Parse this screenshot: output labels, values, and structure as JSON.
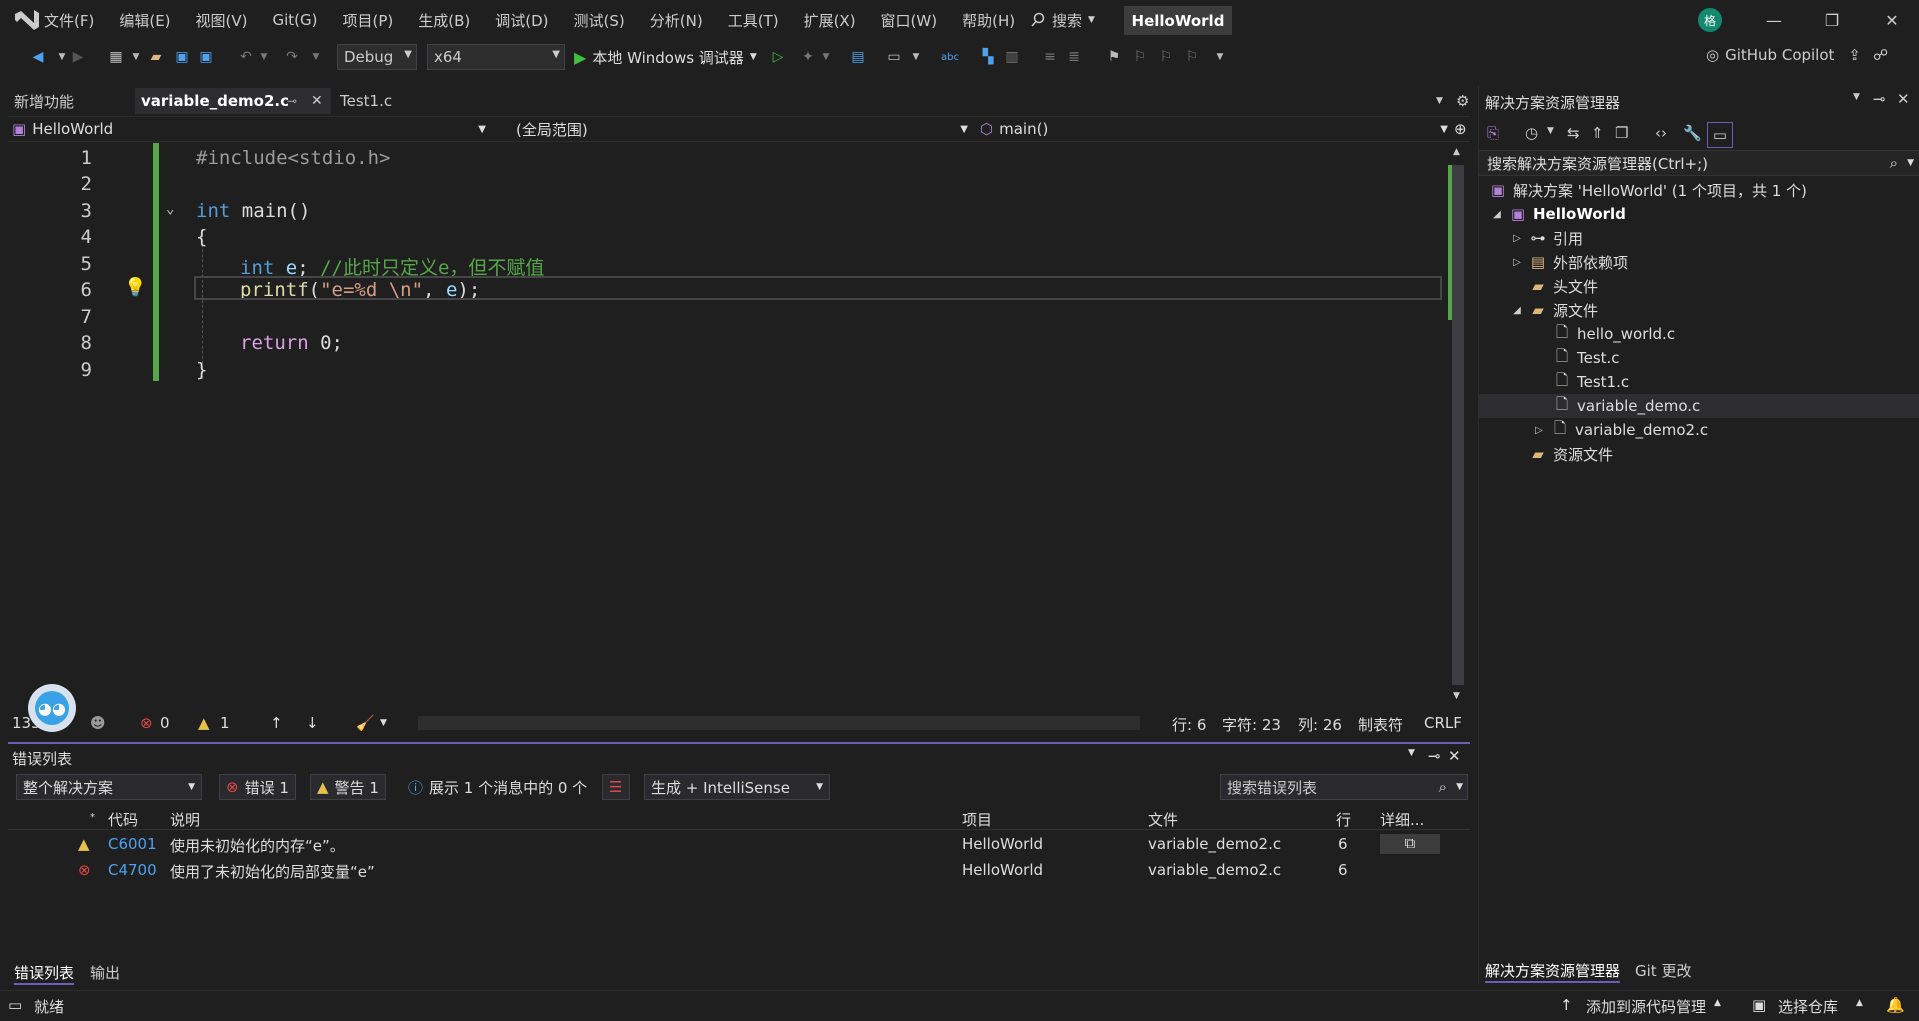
{
  "menu": [
    "文件(F)",
    "编辑(E)",
    "视图(V)",
    "Git(G)",
    "项目(P)",
    "生成(B)",
    "调试(D)",
    "测试(S)",
    "分析(N)",
    "工具(T)",
    "扩展(X)",
    "窗口(W)",
    "帮助(H)"
  ],
  "search_label": "搜索",
  "window_title": "HelloWorld",
  "avatar_initial": "格",
  "toolbar": {
    "config": "Debug",
    "platform": "x64",
    "run_label": "本地 Windows 调试器",
    "copilot": "GitHub Copilot"
  },
  "doc_tabs": [
    "新增功能",
    "variable_demo2.c",
    "Test1.c"
  ],
  "nav": {
    "project": "HelloWorld",
    "scope": "(全局范围)",
    "member": "main()"
  },
  "line_numbers": [
    "1",
    "2",
    "3",
    "4",
    "5",
    "6",
    "7",
    "8",
    "9"
  ],
  "code": {
    "l1": "#include<stdio.h>",
    "l3_kw": "int",
    "l3_rest": " main()",
    "l4": "{",
    "l5_kw": "int",
    "l5_var": " e",
    "l5_semi": ";",
    "l5_cm": " //此时只定义e，但不赋值",
    "l6_fn": "printf",
    "l6_open": "(",
    "l6_str": "\"e=%d \\n\"",
    "l6_mid": ", ",
    "l6_var": "e",
    "l6_close": ");",
    "l8_kw": "return",
    "l8_rest": " 0;",
    "l9": "}"
  },
  "editor_status": {
    "zoom": "133%",
    "errors": "0",
    "warnings": "1",
    "line": "行: 6",
    "char": "字符: 23",
    "col": "列: 26",
    "tabs": "制表符",
    "eol": "CRLF"
  },
  "error_list": {
    "title": "错误列表",
    "scope": "整个解决方案",
    "errors_btn": "错误 1",
    "warnings_btn": "警告 1",
    "messages": "展示 1 个消息中的 0 个",
    "build_filter": "生成 + IntelliSense",
    "search_placeholder": "搜索错误列表",
    "columns": [
      "代码",
      "说明",
      "项目",
      "文件",
      "行",
      "详细..."
    ],
    "rows": [
      {
        "severity": "warning",
        "code": "C6001",
        "desc": "使用未初始化的内存“e”。",
        "project": "HelloWorld",
        "file": "variable_demo2.c",
        "line": "6"
      },
      {
        "severity": "error",
        "code": "C4700",
        "desc": "使用了未初始化的局部变量“e”",
        "project": "HelloWorld",
        "file": "variable_demo2.c",
        "line": "6"
      }
    ],
    "tabs": [
      "错误列表",
      "输出"
    ]
  },
  "solution": {
    "title": "解决方案资源管理器",
    "search_placeholder": "搜索解决方案资源管理器(Ctrl+;)",
    "root": "解决方案 'HelloWorld' (1 个项目，共 1 个)",
    "project": "HelloWorld",
    "refs": "引用",
    "ext_deps": "外部依赖项",
    "headers": "头文件",
    "sources": "源文件",
    "files": [
      "hello_world.c",
      "Test.c",
      "Test1.c",
      "variable_demo.c",
      "variable_demo2.c"
    ],
    "resources": "资源文件",
    "tabs": [
      "解决方案资源管理器",
      "Git 更改"
    ]
  },
  "status": {
    "ready": "就绪",
    "add_source": "添加到源代码管理",
    "select_repo": "选择仓库"
  },
  "colors": {
    "accent": "#6d5db3",
    "gutter_change": "#57a64a",
    "link": "#4ea1f0"
  }
}
